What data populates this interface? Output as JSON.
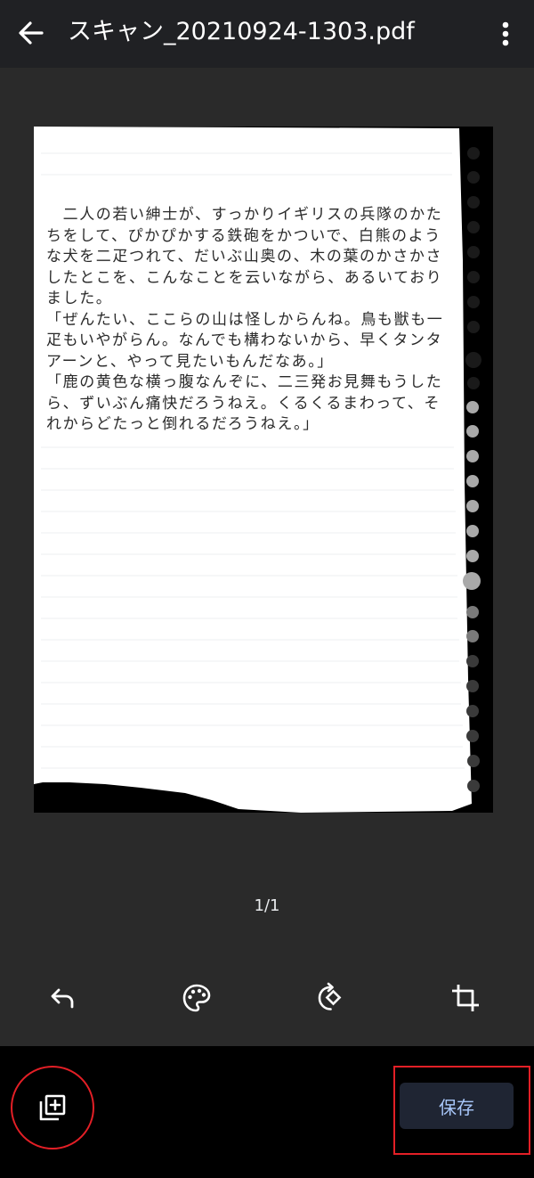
{
  "topbar": {
    "title": "スキャン_20210924-1303.pdf",
    "back_icon": "arrow-back-icon",
    "menu_icon": "more-vert-icon"
  },
  "document": {
    "lines": [
      "　二人の若い紳士が、すっかりイギリスの兵隊のかた",
      "ちをして、ぴかぴかする鉄砲をかついで、白熊のよう",
      "な犬を二疋つれて、だいぶ山奥の、木の葉のかさかさ",
      "したとこを、こんなことを云いながら、あるいており",
      "ました。",
      "「ぜんたい、ここらの山は怪しからんね。鳥も獣も一",
      "疋もいやがらん。なんでも構わないから、早くタンタ",
      "アーンと、やって見たいもんだなあ。」",
      "「鹿の黄色な横っ腹なんぞに、二三発お見舞もうした",
      "ら、ずいぶん痛快だろうねえ。くるくるまわって、そ",
      "れからどたっと倒れるだろうねえ。」"
    ]
  },
  "page_indicator": "1/1",
  "toolbar": {
    "undo_icon": "undo-icon",
    "palette_icon": "palette-icon",
    "rotate_icon": "rotate-icon",
    "crop_icon": "crop-icon"
  },
  "bottom": {
    "add_page_icon": "add-page-icon",
    "save_label": "保存"
  },
  "colors": {
    "topbar_bg": "#202124",
    "body_bg": "#2a2a2a",
    "bottombar_bg": "#000000",
    "save_bg": "#1f2533",
    "save_text": "#a8c7fa",
    "highlight": "#e31f26"
  }
}
